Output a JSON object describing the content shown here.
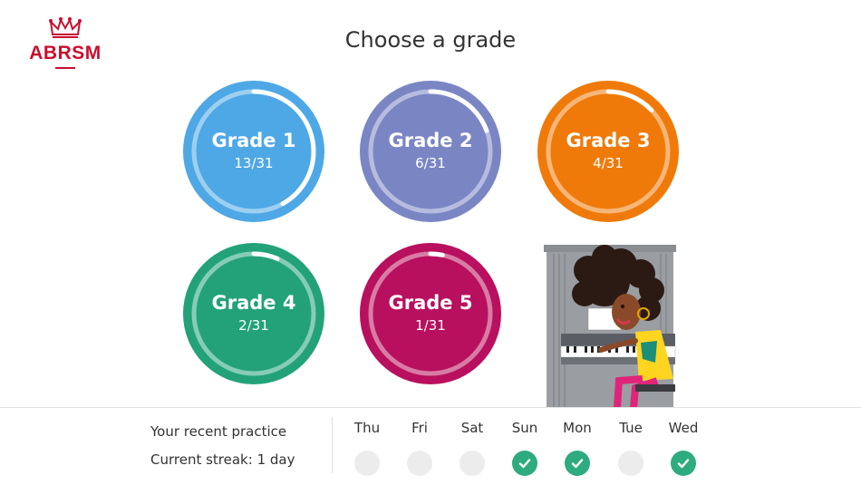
{
  "brand": {
    "logo_text": "ABRSM",
    "color": "#c8102e"
  },
  "page": {
    "title": "Choose a grade"
  },
  "grades": [
    {
      "name": "Grade 1",
      "progress": "13/31",
      "completed": 13,
      "total": 31,
      "color": "#4ea8e6"
    },
    {
      "name": "Grade 2",
      "progress": "6/31",
      "completed": 6,
      "total": 31,
      "color": "#7a86c4"
    },
    {
      "name": "Grade 3",
      "progress": "4/31",
      "completed": 4,
      "total": 31,
      "color": "#ef7a0a"
    },
    {
      "name": "Grade 4",
      "progress": "2/31",
      "completed": 2,
      "total": 31,
      "color": "#23a27a"
    },
    {
      "name": "Grade 5",
      "progress": "1/31",
      "completed": 1,
      "total": 31,
      "color": "#b8105e"
    }
  ],
  "practice": {
    "recent_label": "Your recent practice",
    "streak_label": "Current streak: 1 day",
    "check_color": "#2eab7f",
    "days": [
      {
        "label": "Thu",
        "done": false
      },
      {
        "label": "Fri",
        "done": false
      },
      {
        "label": "Sat",
        "done": false
      },
      {
        "label": "Sun",
        "done": true
      },
      {
        "label": "Mon",
        "done": true
      },
      {
        "label": "Tue",
        "done": false
      },
      {
        "label": "Wed",
        "done": true
      }
    ]
  }
}
